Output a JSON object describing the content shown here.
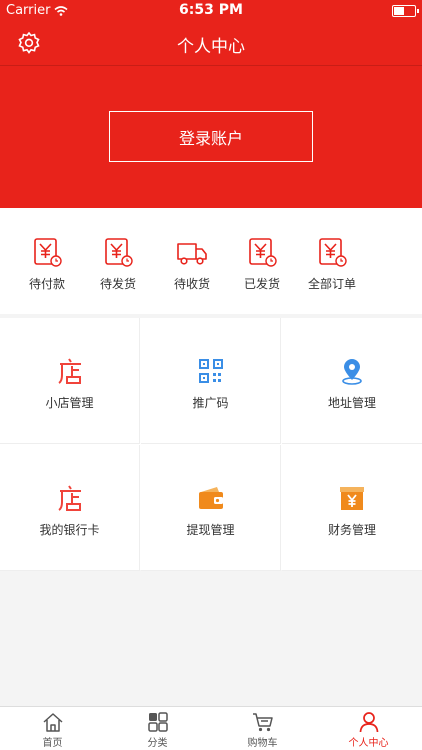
{
  "status": {
    "carrier": "Carrier",
    "time": "6:53 PM"
  },
  "nav": {
    "title": "个人中心"
  },
  "hero": {
    "login_label": "登录账户"
  },
  "orders": [
    {
      "label": "待付款",
      "icon": "yen-clock-icon"
    },
    {
      "label": "待发货",
      "icon": "yen-clock-icon"
    },
    {
      "label": "待收货",
      "icon": "truck-icon"
    },
    {
      "label": "已发货",
      "icon": "yen-clock-icon"
    },
    {
      "label": "全部订单",
      "icon": "yen-clock-icon"
    }
  ],
  "grid": [
    {
      "label": "小店管理",
      "icon": "shop-icon"
    },
    {
      "label": "推广码",
      "icon": "qrcode-icon"
    },
    {
      "label": "地址管理",
      "icon": "location-pin-icon"
    },
    {
      "label": "我的银行卡",
      "icon": "shop-icon"
    },
    {
      "label": "提现管理",
      "icon": "wallet-icon"
    },
    {
      "label": "财务管理",
      "icon": "yen-box-icon"
    }
  ],
  "tabs": [
    {
      "label": "首页",
      "icon": "home-icon"
    },
    {
      "label": "分类",
      "icon": "category-icon"
    },
    {
      "label": "购物车",
      "icon": "cart-icon"
    },
    {
      "label": "个人中心",
      "icon": "person-icon"
    }
  ],
  "active_tab": "个人中心",
  "colors": {
    "brand": "#e8231b",
    "icon_blue": "#3a8ee6",
    "icon_orange": "#f08a1c"
  }
}
